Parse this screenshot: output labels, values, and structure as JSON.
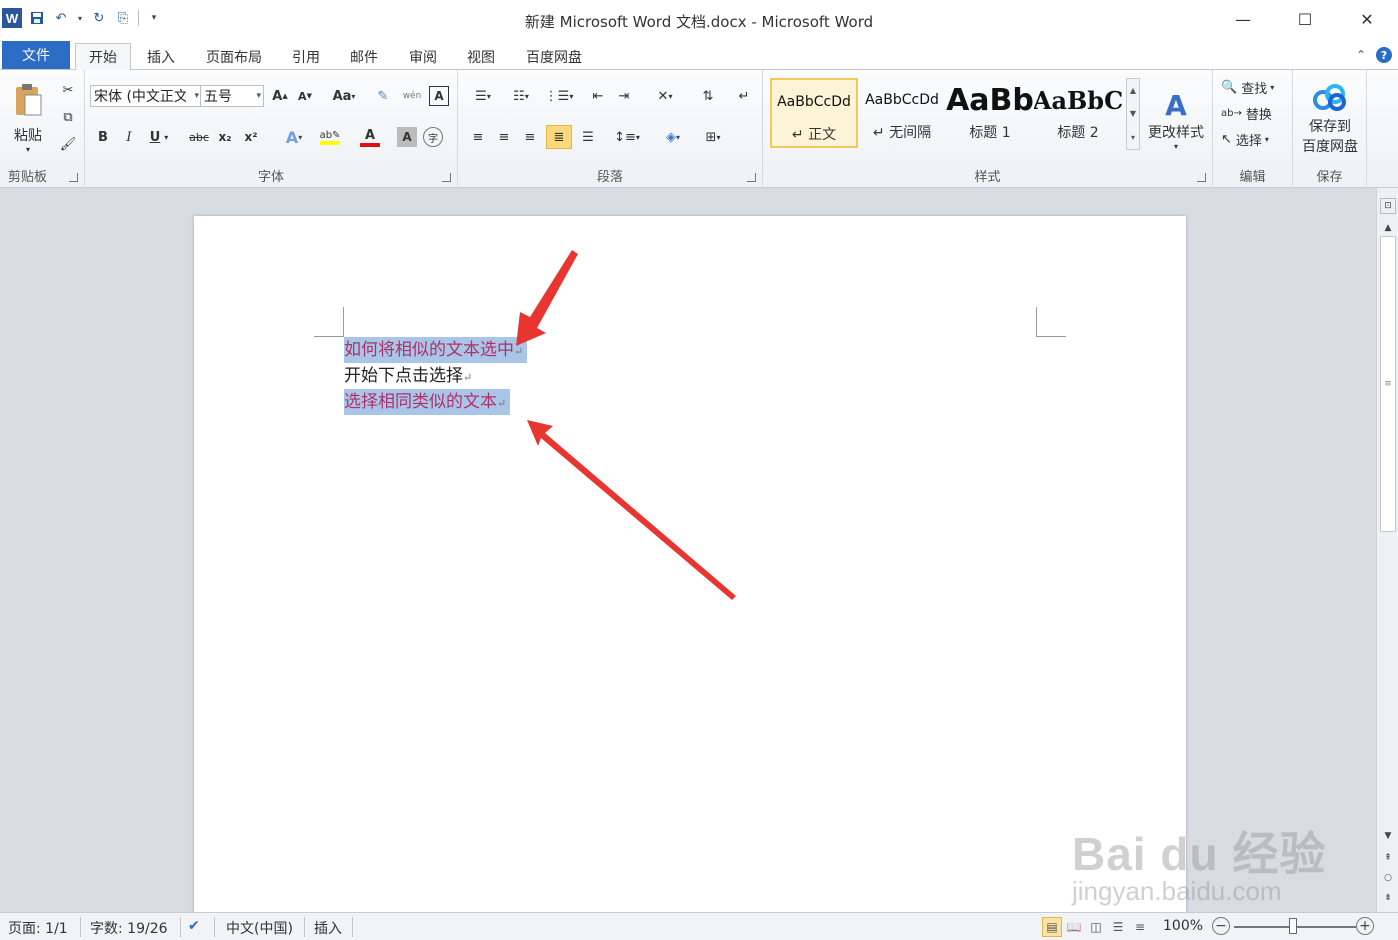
{
  "window": {
    "title": "新建 Microsoft Word 文档.docx - Microsoft Word",
    "app_icon": "W",
    "minimize": "—",
    "maximize": "☐",
    "close": "✕"
  },
  "tabs": {
    "file": "文件",
    "items": [
      "开始",
      "插入",
      "页面布局",
      "引用",
      "邮件",
      "审阅",
      "视图",
      "百度网盘"
    ],
    "active": "开始"
  },
  "ribbon": {
    "clipboard": {
      "paste": "粘贴",
      "label": "剪贴板"
    },
    "font": {
      "name": "宋体 (中文正文",
      "size": "五号",
      "grow": "A",
      "shrink": "A",
      "case": "Aa",
      "bold": "B",
      "italic": "I",
      "underline": "U",
      "strike": "abc",
      "subscript": "x₂",
      "superscript": "x²",
      "label": "字体"
    },
    "paragraph": {
      "label": "段落"
    },
    "styles": {
      "items": [
        {
          "preview": "AaBbCcDd",
          "name": "↵ 正文"
        },
        {
          "preview": "AaBbCcDd",
          "name": "↵ 无间隔"
        },
        {
          "preview": "AaBb",
          "name": "标题 1"
        },
        {
          "preview": "AaBbC",
          "name": "标题 2"
        }
      ],
      "change": "更改样式",
      "label": "样式"
    },
    "editing": {
      "find": "查找",
      "replace": "替换",
      "select": "选择",
      "label": "编辑"
    },
    "save": {
      "line1": "保存到",
      "line2": "百度网盘",
      "label": "保存"
    }
  },
  "document": {
    "lines": [
      {
        "text": "如何将相似的文本选中",
        "mark": "↵"
      },
      {
        "text": "开始下点击选择",
        "mark": "↵"
      },
      {
        "text": "选择相同类似的文本",
        "mark": "↵"
      }
    ]
  },
  "status": {
    "page": "页面: 1/1",
    "words": "字数: 19/26",
    "language": "中文(中国)",
    "mode": "插入",
    "zoom": "100%",
    "zoom_value": 100
  },
  "watermark": {
    "text": "Bai du 经验",
    "sub": "jingyan.baidu.com"
  },
  "colors": {
    "selection": "#a9c6e8",
    "selected_text": "#b0306a",
    "accent": "#2b6cc4",
    "arrow": "#e8352f"
  }
}
